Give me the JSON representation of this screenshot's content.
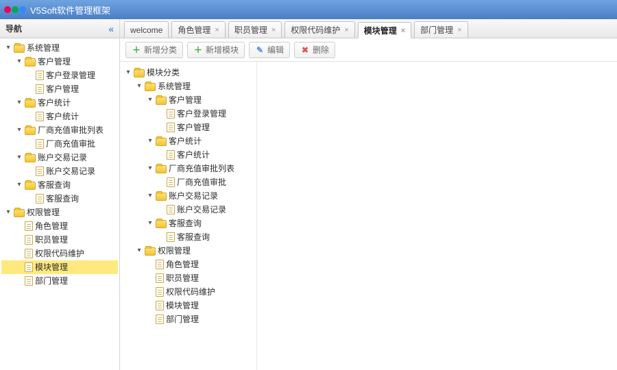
{
  "app_title": "V5Soft软件管理框架",
  "nav_title": "导航",
  "tabs": [
    {
      "label": "welcome",
      "closable": false,
      "active": false
    },
    {
      "label": "角色管理",
      "closable": true,
      "active": false
    },
    {
      "label": "职员管理",
      "closable": true,
      "active": false
    },
    {
      "label": "权限代码维护",
      "closable": true,
      "active": false
    },
    {
      "label": "模块管理",
      "closable": true,
      "active": true
    },
    {
      "label": "部门管理",
      "closable": true,
      "active": false
    }
  ],
  "toolbar": {
    "add_cat": "新增分类",
    "add_mod": "新增模块",
    "edit": "编辑",
    "del": "删除"
  },
  "nav_tree": [
    {
      "l": "系统管理",
      "t": "folder",
      "d": 0,
      "o": true
    },
    {
      "l": "客户管理",
      "t": "folder",
      "d": 1,
      "o": true
    },
    {
      "l": "客户登录管理",
      "t": "page",
      "d": 2
    },
    {
      "l": "客户管理",
      "t": "page",
      "d": 2
    },
    {
      "l": "客户统计",
      "t": "folder",
      "d": 1,
      "o": true
    },
    {
      "l": "客户统计",
      "t": "page",
      "d": 2
    },
    {
      "l": "厂商充值审批列表",
      "t": "folder",
      "d": 1,
      "o": true
    },
    {
      "l": "厂商充值审批",
      "t": "page",
      "d": 2
    },
    {
      "l": "账户交易记录",
      "t": "folder",
      "d": 1,
      "o": true
    },
    {
      "l": "账户交易记录",
      "t": "page",
      "d": 2
    },
    {
      "l": "客服查询",
      "t": "folder",
      "d": 1,
      "o": true
    },
    {
      "l": "客服查询",
      "t": "page",
      "d": 2
    },
    {
      "l": "权限管理",
      "t": "folder",
      "d": 0,
      "o": true
    },
    {
      "l": "角色管理",
      "t": "page",
      "d": 1
    },
    {
      "l": "职员管理",
      "t": "page",
      "d": 1
    },
    {
      "l": "权限代码维护",
      "t": "page",
      "d": 1
    },
    {
      "l": "模块管理",
      "t": "page",
      "d": 1,
      "sel": true
    },
    {
      "l": "部门管理",
      "t": "page",
      "d": 1
    }
  ],
  "mod_tree": [
    {
      "l": "模块分类",
      "t": "folder",
      "d": 0,
      "o": true
    },
    {
      "l": "系统管理",
      "t": "folder",
      "d": 1,
      "o": true
    },
    {
      "l": "客户管理",
      "t": "folder",
      "d": 2,
      "o": true
    },
    {
      "l": "客户登录管理",
      "t": "page",
      "d": 3
    },
    {
      "l": "客户管理",
      "t": "page",
      "d": 3
    },
    {
      "l": "客户统计",
      "t": "folder",
      "d": 2,
      "o": true
    },
    {
      "l": "客户统计",
      "t": "page",
      "d": 3
    },
    {
      "l": "厂商充值审批列表",
      "t": "folder",
      "d": 2,
      "o": true
    },
    {
      "l": "厂商充值审批",
      "t": "page",
      "d": 3
    },
    {
      "l": "账户交易记录",
      "t": "folder",
      "d": 2,
      "o": true
    },
    {
      "l": "账户交易记录",
      "t": "page",
      "d": 3
    },
    {
      "l": "客服查询",
      "t": "folder",
      "d": 2,
      "o": true
    },
    {
      "l": "客服查询",
      "t": "page",
      "d": 3
    },
    {
      "l": "权限管理",
      "t": "folder",
      "d": 1,
      "o": true
    },
    {
      "l": "角色管理",
      "t": "page",
      "d": 2
    },
    {
      "l": "职员管理",
      "t": "page",
      "d": 2
    },
    {
      "l": "权限代码维护",
      "t": "page",
      "d": 2
    },
    {
      "l": "模块管理",
      "t": "page",
      "d": 2
    },
    {
      "l": "部门管理",
      "t": "page",
      "d": 2
    }
  ]
}
